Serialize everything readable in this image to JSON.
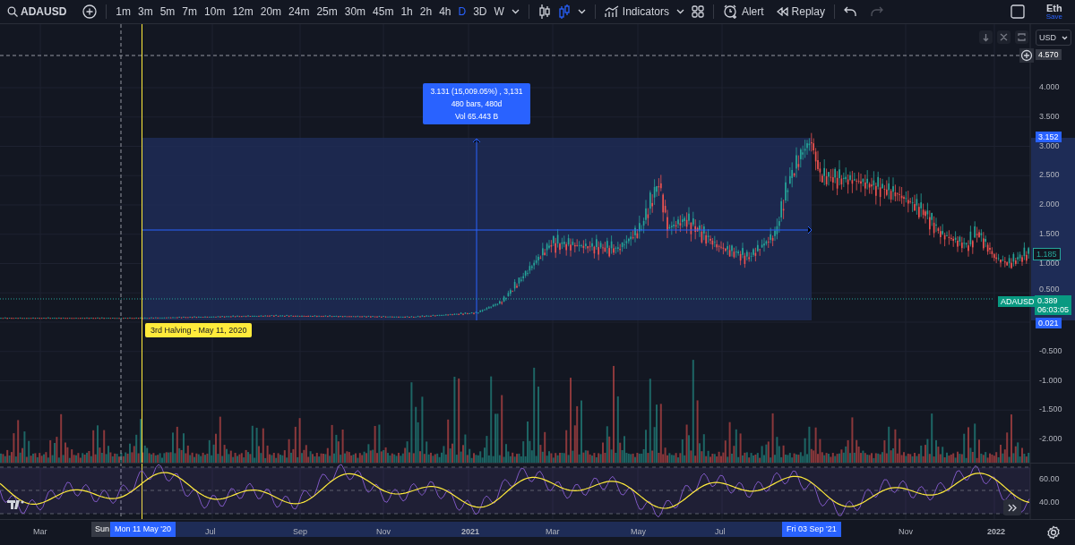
{
  "toolbar": {
    "symbol": "ADAUSD",
    "intervals": [
      {
        "label": "1m",
        "selected": false
      },
      {
        "label": "3m",
        "selected": false
      },
      {
        "label": "5m",
        "selected": false
      },
      {
        "label": "7m",
        "selected": false
      },
      {
        "label": "10m",
        "selected": false
      },
      {
        "label": "12m",
        "selected": false
      },
      {
        "label": "20m",
        "selected": false
      },
      {
        "label": "24m",
        "selected": false
      },
      {
        "label": "25m",
        "selected": false
      },
      {
        "label": "30m",
        "selected": false
      },
      {
        "label": "45m",
        "selected": false
      },
      {
        "label": "1h",
        "selected": false
      },
      {
        "label": "2h",
        "selected": false
      },
      {
        "label": "4h",
        "selected": false
      },
      {
        "label": "D",
        "selected": true
      },
      {
        "label": "3D",
        "selected": false
      },
      {
        "label": "W",
        "selected": false
      }
    ],
    "indicators": "Indicators",
    "alert": "Alert",
    "replay": "Replay",
    "redo_disabled": true,
    "user": {
      "name": "Eth",
      "action": "Save"
    }
  },
  "currency": "USD",
  "price_axis": {
    "ticks": [
      "4.000",
      "3.500",
      "3.000",
      "2.500",
      "2.000",
      "1.500",
      "1.000",
      "0.500",
      "-0.500",
      "-1.000",
      "-1.500",
      "-2.000"
    ],
    "crosshair_price": "4.570"
  },
  "rsi_axis": {
    "ticks": [
      "60.00",
      "40.00"
    ]
  },
  "measure": {
    "lines": [
      "3.131 (15,009.05%) , 3,131",
      "480 bars, 480d",
      "Vol 65.443 B"
    ],
    "high_price": "3.152",
    "low_price": "0.021"
  },
  "annotation": "3rd Halving - May 11, 2020",
  "last_price": {
    "symbol": "ADAUSD",
    "price": "0.389",
    "countdown": "06:03:05"
  },
  "marker_price": "1.185",
  "time_axis": {
    "ticks": [
      "Mar",
      "Jul",
      "Sep",
      "Nov",
      "2021",
      "Mar",
      "May",
      "Jul",
      "Nov",
      "2022"
    ],
    "crosshair_day": "Sun",
    "range_start": "Mon 11 May '20",
    "range_end": "Fri 03 Sep '21"
  }
}
